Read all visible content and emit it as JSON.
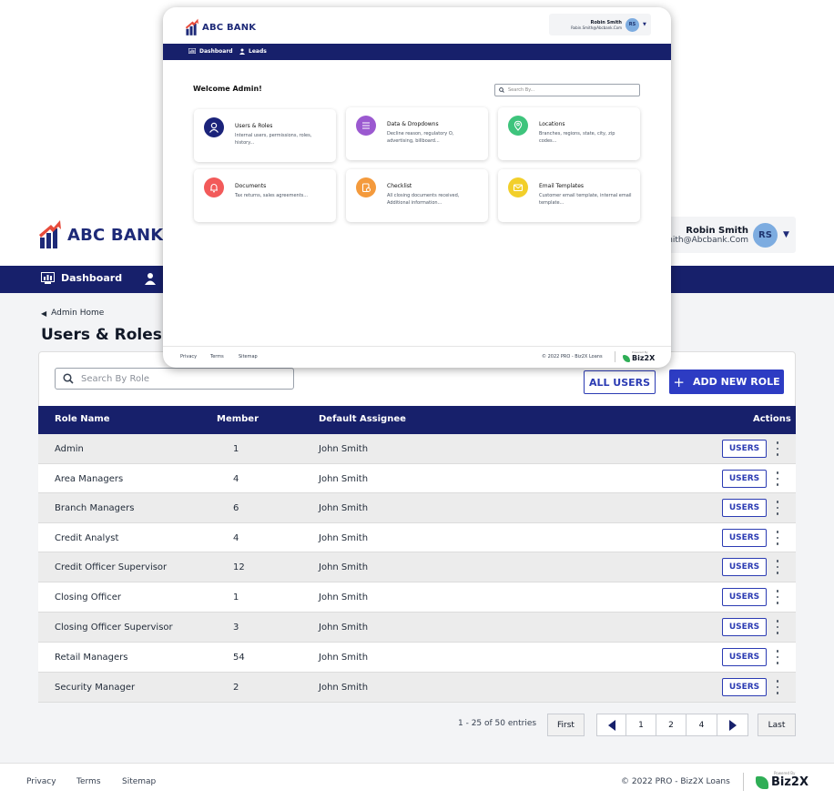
{
  "app": {
    "brand": "ABC BANK",
    "brand_color": "#1e2a78",
    "accent": "#2d3cc3",
    "nav_bg": "#17206b"
  },
  "user": {
    "name": "Robin Smith",
    "email": "Robin.Smith@Abcbank.Com",
    "initials": "RS"
  },
  "nav": {
    "items": [
      {
        "label": "Dashboard",
        "icon": "dashboard-icon"
      },
      {
        "label": "Leads",
        "icon": "person-icon"
      }
    ]
  },
  "breadcrumb": {
    "label": "Admin Home"
  },
  "page": {
    "title": "Users & Roles"
  },
  "search": {
    "placeholder": "Search By Role"
  },
  "actions": {
    "all_users": "ALL USERS",
    "add_role": "ADD NEW ROLE",
    "add_icon": "+"
  },
  "table": {
    "headers": {
      "role": "Role Name",
      "member": "Member",
      "assignee": "Default Assignee",
      "actions": "Actions"
    },
    "users_label": "USERS",
    "rows": [
      {
        "role": "Admin",
        "member": "1",
        "assignee": "John Smith"
      },
      {
        "role": "Area Managers",
        "member": "4",
        "assignee": "John Smith"
      },
      {
        "role": "Branch Managers",
        "member": "6",
        "assignee": "John Smith"
      },
      {
        "role": "Credit Analyst",
        "member": "4",
        "assignee": "John Smith"
      },
      {
        "role": "Credit Officer Supervisor",
        "member": "12",
        "assignee": "John Smith"
      },
      {
        "role": "Closing Officer",
        "member": "1",
        "assignee": "John Smith"
      },
      {
        "role": "Closing Officer Supervisor",
        "member": "3",
        "assignee": "John Smith"
      },
      {
        "role": "Retail Managers",
        "member": "54",
        "assignee": "John Smith"
      },
      {
        "role": "Security Manager",
        "member": "2",
        "assignee": "John Smith"
      }
    ]
  },
  "pagination": {
    "info": "1 - 25 of 50 entries",
    "first": "First",
    "last": "Last",
    "pages": [
      "1",
      "2",
      "4"
    ]
  },
  "footer": {
    "privacy": "Privacy",
    "terms": "Terms",
    "sitemap": "Sitemap",
    "copyright": "© 2022 PRO - Biz2X Loans",
    "powered_by": "Powered By",
    "biz2x": "Biz2X"
  },
  "modal": {
    "welcome": "Welcome Admin!",
    "search_placeholder": "Search By...",
    "cards": [
      {
        "title": "Users & Roles",
        "desc": "Internal users, permissions, roles, history...",
        "icon": "user-icon",
        "color": "#1b237a"
      },
      {
        "title": "Data & Dropdowns",
        "desc": "Decline reason, regulatory O, advertising, billboard...",
        "icon": "list-icon",
        "color": "#9b59d0"
      },
      {
        "title": "Locations",
        "desc": "Branches, regions, state, city, zip codes...",
        "icon": "location-icon",
        "color": "#3ec47c"
      },
      {
        "title": "Documents",
        "desc": "Tax returns, sales agreements...",
        "icon": "bell-icon",
        "color": "#f25a5a"
      },
      {
        "title": "Checklist",
        "desc": "All closing documents received, Additional information...",
        "icon": "checklist-icon",
        "color": "#f49a3c"
      },
      {
        "title": "Email Templates",
        "desc": "Customer email template, internal email template...",
        "icon": "mail-icon",
        "color": "#f2cf2a"
      }
    ]
  }
}
